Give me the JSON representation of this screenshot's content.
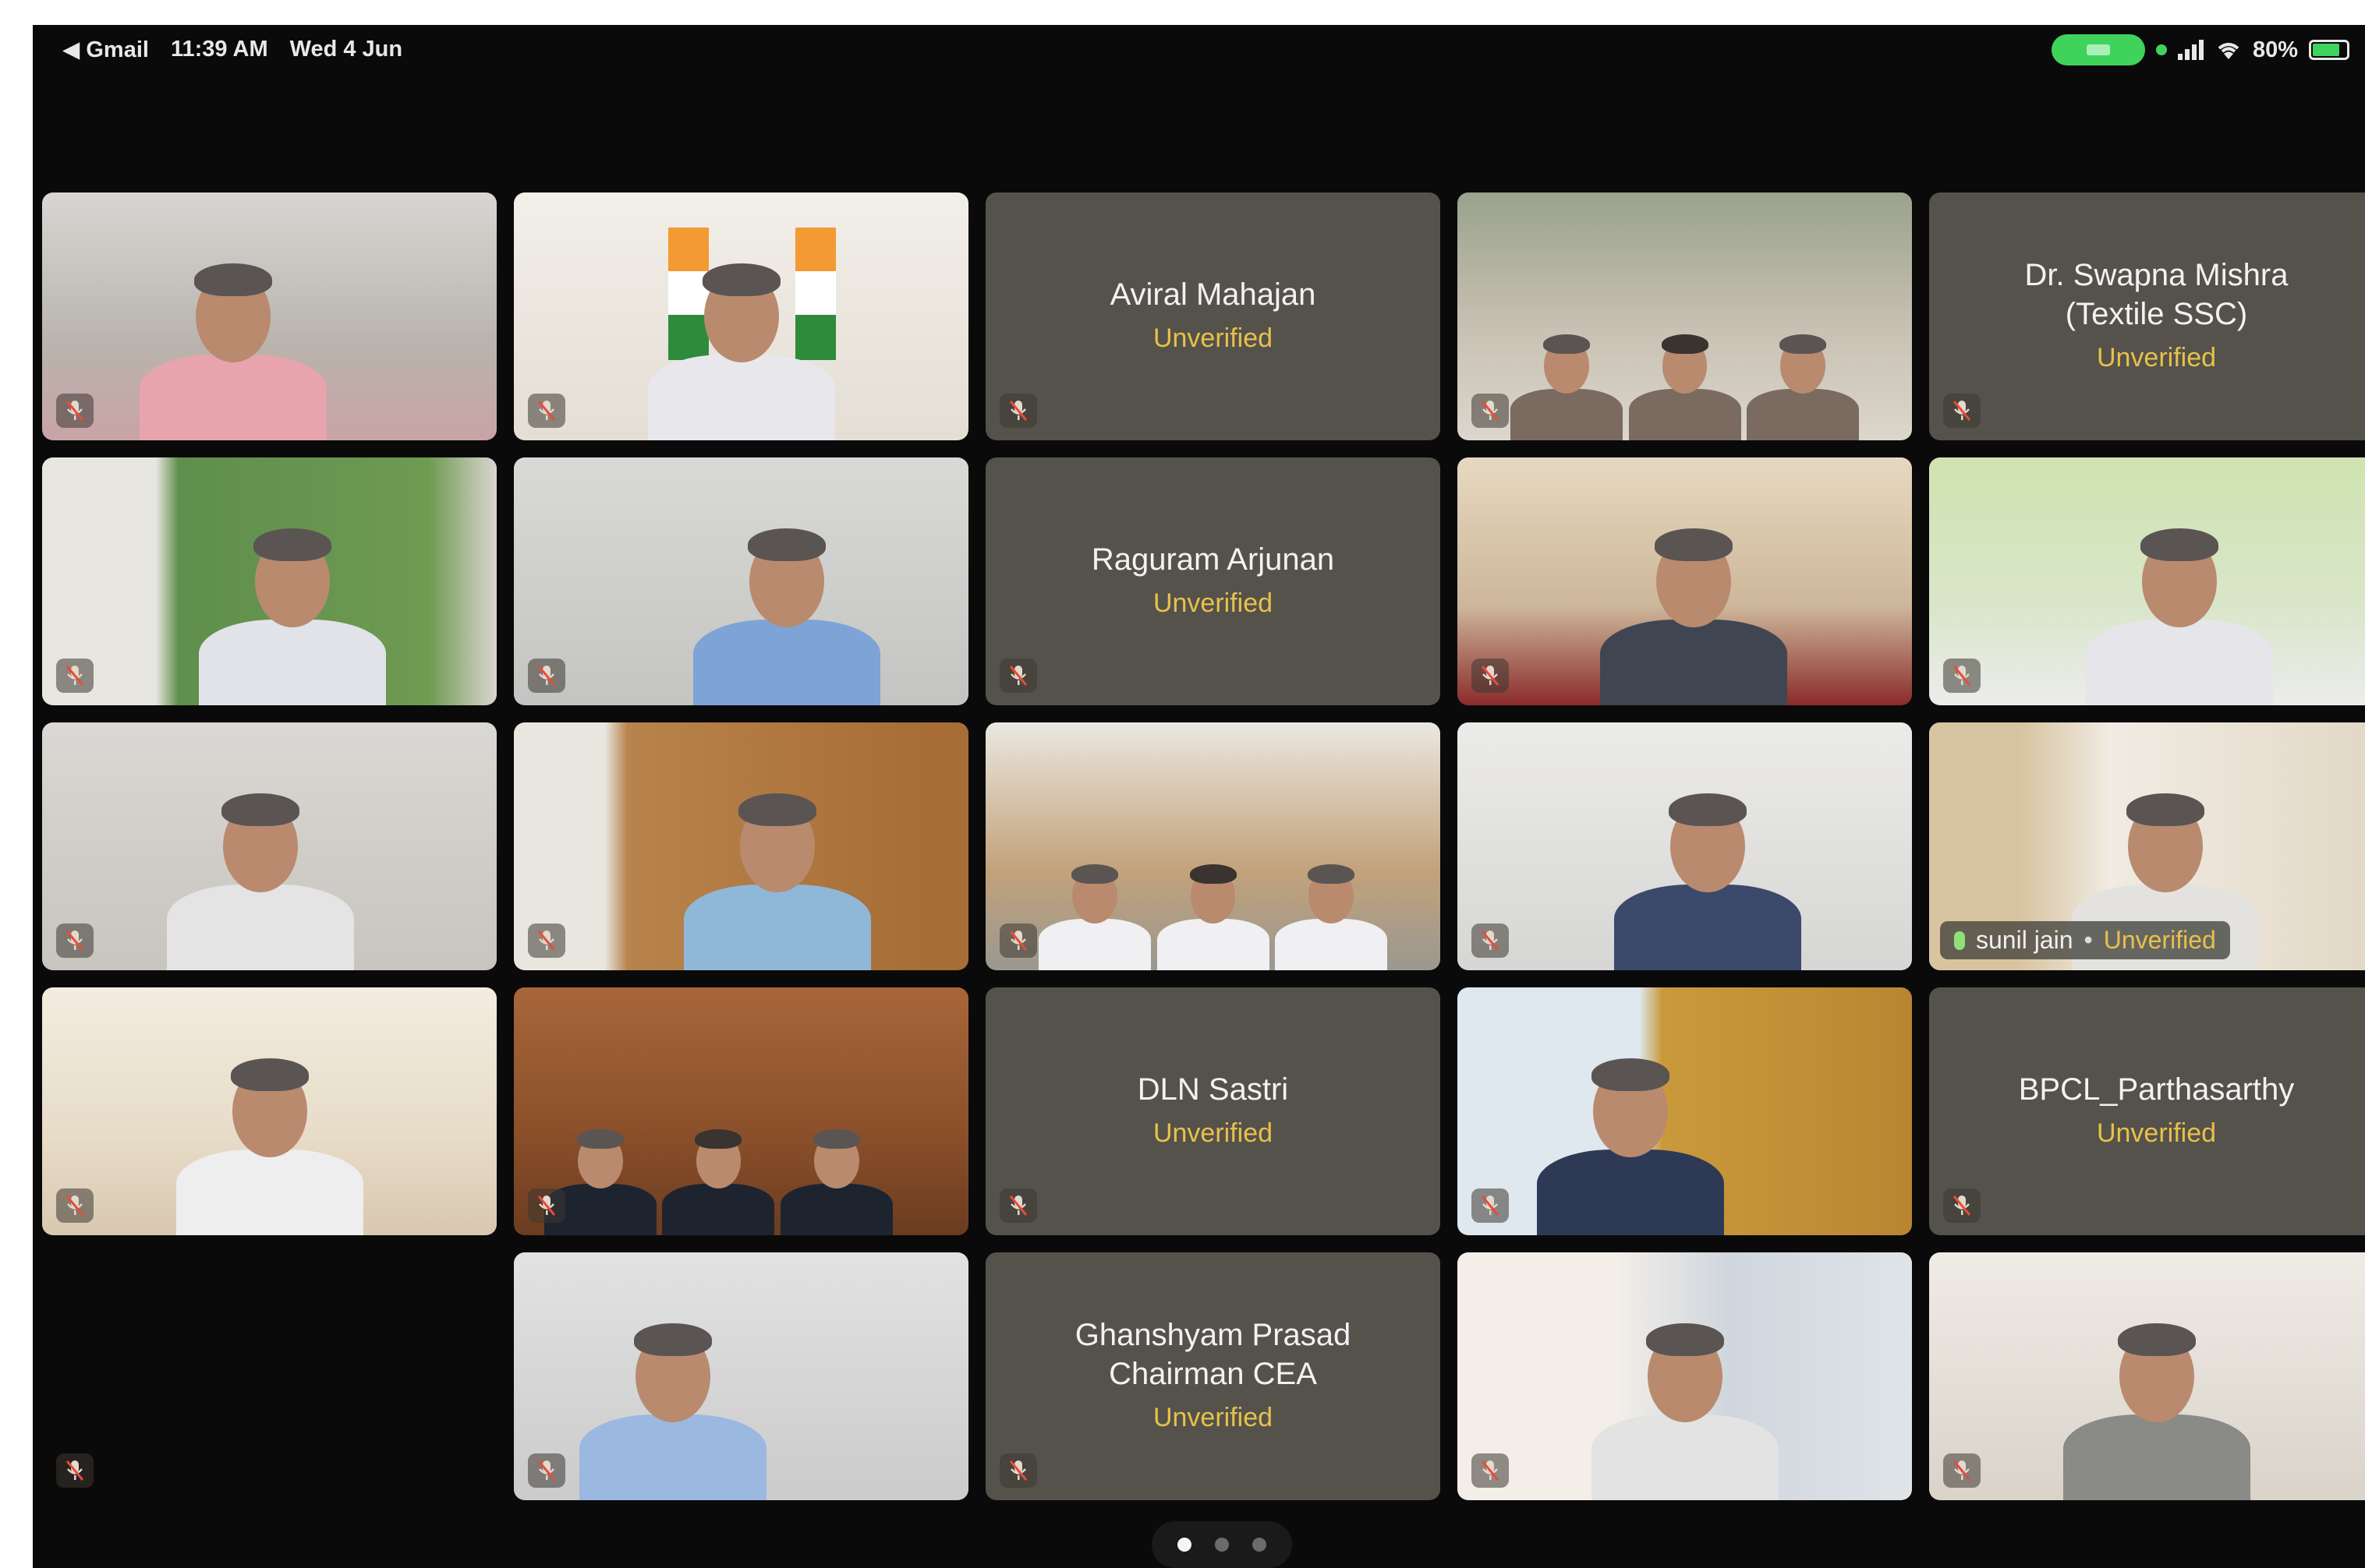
{
  "status_bar": {
    "back_app": "◀ Gmail",
    "time": "11:39 AM",
    "date": "Wed 4 Jun",
    "battery_percent": "80%",
    "battery_level": 0.8
  },
  "tiles": [
    {
      "kind": "video"
    },
    {
      "kind": "video"
    },
    {
      "kind": "name",
      "name": "Aviral Mahajan",
      "status": "Unverified"
    },
    {
      "kind": "video"
    },
    {
      "kind": "name",
      "name": "Dr. Swapna Mishra\n(Textile SSC)",
      "status": "Unverified"
    },
    {
      "kind": "video"
    },
    {
      "kind": "video"
    },
    {
      "kind": "name",
      "name": "Raguram Arjunan",
      "status": "Unverified"
    },
    {
      "kind": "video"
    },
    {
      "kind": "video"
    },
    {
      "kind": "video"
    },
    {
      "kind": "video"
    },
    {
      "kind": "video"
    },
    {
      "kind": "video"
    },
    {
      "kind": "video",
      "active": true,
      "label": "sunil jain",
      "label_sep": "•",
      "label_status": "Unverified"
    },
    {
      "kind": "video"
    },
    {
      "kind": "video"
    },
    {
      "kind": "name",
      "name": "DLN Sastri",
      "status": "Unverified"
    },
    {
      "kind": "video"
    },
    {
      "kind": "name",
      "name": "BPCL_Parthasarthy",
      "status": "Unverified"
    },
    {
      "kind": "empty"
    },
    {
      "kind": "video"
    },
    {
      "kind": "name",
      "name": "Ghanshyam Prasad\nChairman CEA",
      "status": "Unverified"
    },
    {
      "kind": "video"
    },
    {
      "kind": "video"
    }
  ],
  "pager": {
    "pages": 3,
    "current": 1
  },
  "colors": {
    "tile_bg": "#55524c",
    "unverified": "#e7c14a",
    "active_outline": "#7fd6cf",
    "status_green": "#3fd35c"
  }
}
